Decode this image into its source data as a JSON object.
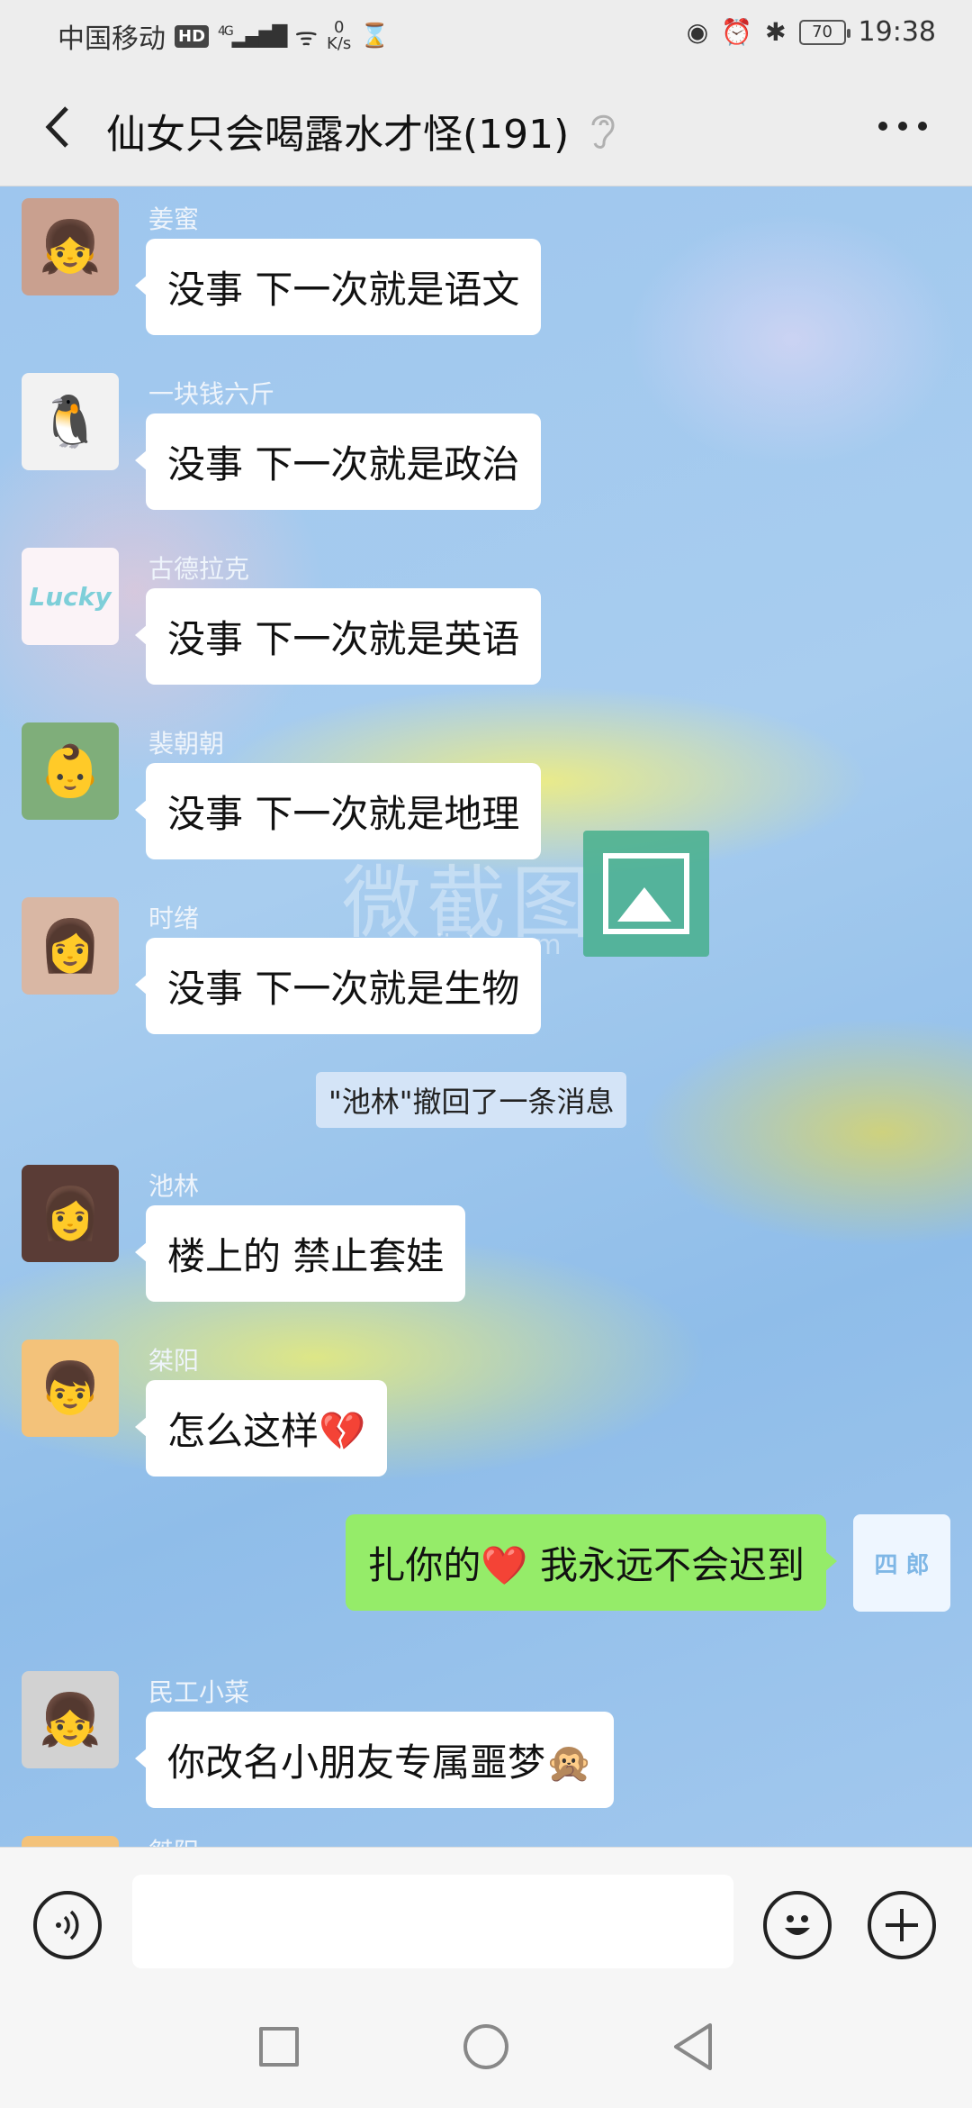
{
  "status_bar": {
    "carrier": "中国移动",
    "hd": "HD",
    "network": "4G",
    "speed_value": "0",
    "speed_unit": "K/s",
    "battery": "70",
    "time": "19:38"
  },
  "header": {
    "title": "仙女只会喝露水才怪(191)"
  },
  "messages": [
    {
      "sender": "姜蜜",
      "text": "没事 下一次就是语文",
      "avatar_bg": "#c9a08f",
      "avatar_icon": "girl-portrait"
    },
    {
      "sender": "一块钱六斤",
      "text": "没事 下一次就是政治",
      "avatar_bg": "#f2f2f2",
      "avatar_icon": "penguin-watermelon"
    },
    {
      "sender": "古德拉克",
      "text": "没事 下一次就是英语",
      "avatar_bg": "#fbf3f7",
      "avatar_icon": "lucky-text"
    },
    {
      "sender": "裴朝朝",
      "text": "没事 下一次就是地理",
      "avatar_bg": "#7fae7a",
      "avatar_icon": "cartoon-girl"
    },
    {
      "sender": "时绪",
      "text": "没事 下一次就是生物",
      "avatar_bg": "#d9b7a4",
      "avatar_icon": "girl-portrait"
    },
    {
      "sender": "池林",
      "text": "楼上的 禁止套娃",
      "avatar_bg": "#5a3c36",
      "avatar_icon": "girl-portrait"
    },
    {
      "sender": "桀阳",
      "text": "怎么这样💔",
      "avatar_bg": "#f3c27a",
      "avatar_icon": "crayon-shin"
    },
    {
      "sender": "",
      "text": "扎你的❤️ 我永远不会迟到",
      "avatar_bg": "#eef6ff",
      "avatar_icon": "sticker-avatar",
      "mine": true
    },
    {
      "sender": "民工小菜",
      "text": "你改名小朋友专属噩梦🙊",
      "avatar_bg": "#d2d2d2",
      "avatar_icon": "girl-portrait"
    },
    {
      "sender": "桀阳",
      "text": "",
      "avatar_bg": "#f3c27a",
      "avatar_icon": "crayon-shin"
    }
  ],
  "system_note": "\"池林\"撤回了一条消息",
  "watermark": {
    "text": "微截图",
    "url": "www.vjietu.com"
  },
  "input": {
    "placeholder": ""
  },
  "colors": {
    "bubble_mine": "#95ec69",
    "bubble_other": "#ffffff",
    "header_bg": "#ededed"
  }
}
